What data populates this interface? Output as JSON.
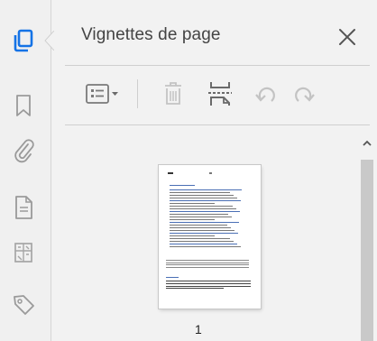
{
  "panel": {
    "title": "Vignettes de page",
    "page_label": "1"
  },
  "left_toolbar": {
    "icons": [
      "pages-icon",
      "bookmark-icon",
      "attachment-icon",
      "document-icon",
      "layers-icon",
      "tag-icon"
    ],
    "active": "pages-icon"
  },
  "toolbar": {
    "icons": [
      "thumbnail-options-icon",
      "delete-icon",
      "insert-pages-icon",
      "rotate-left-icon",
      "rotate-right-icon"
    ]
  },
  "colors": {
    "accent": "#1473e6",
    "icon_gray": "#8c8c8c",
    "disabled_gray": "#c3c3c3"
  }
}
